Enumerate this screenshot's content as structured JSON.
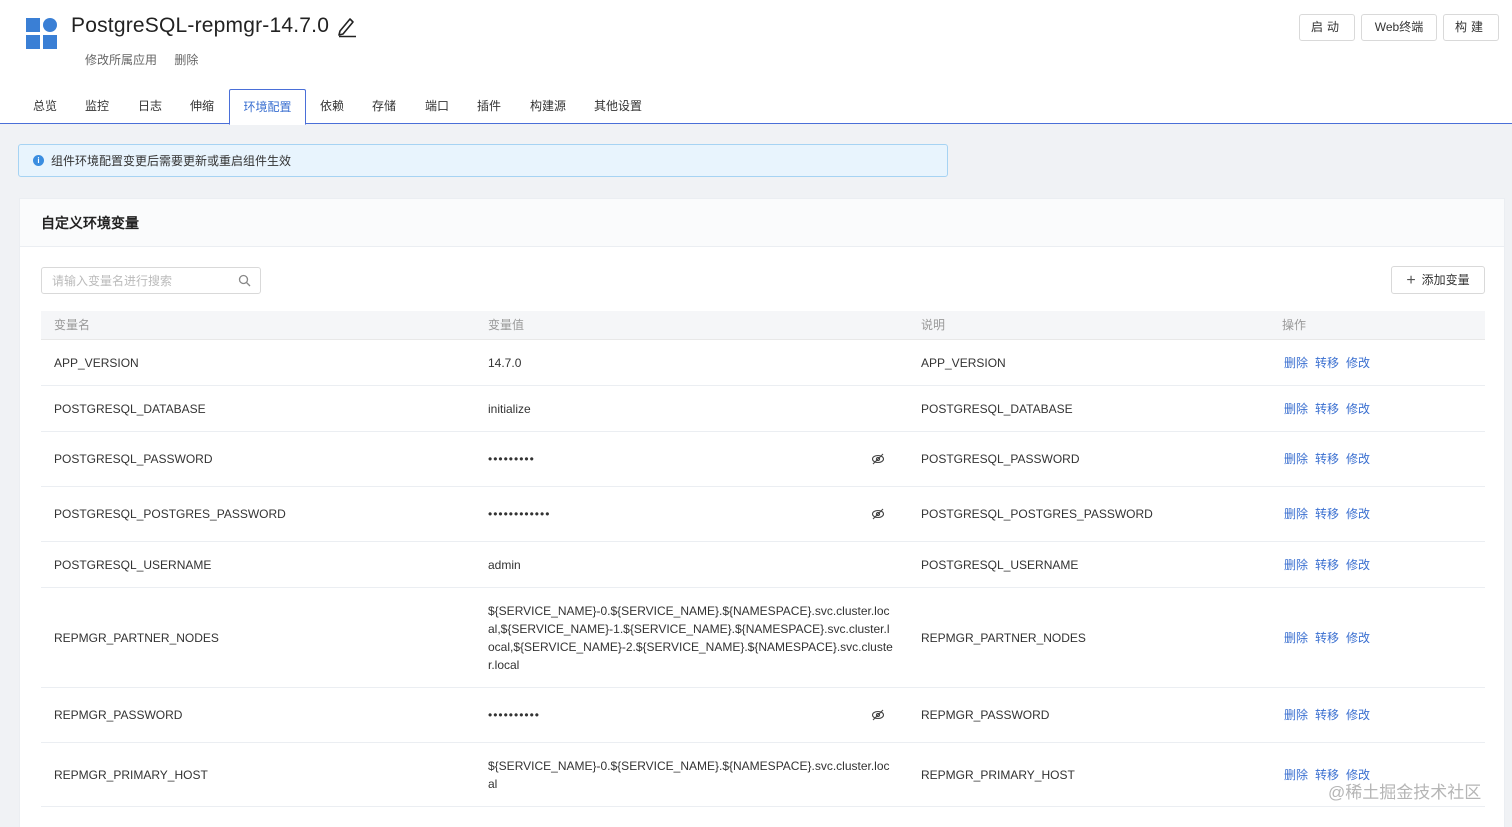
{
  "app": {
    "title": "PostgreSQL-repmgr-14.7.0",
    "sub_actions": [
      "修改所属应用",
      "删除"
    ]
  },
  "top_buttons": {
    "start": "启动",
    "web_terminal": "Web终端",
    "build": "构建"
  },
  "tabs": [
    {
      "label": "总览"
    },
    {
      "label": "监控"
    },
    {
      "label": "日志"
    },
    {
      "label": "伸缩"
    },
    {
      "label": "环境配置",
      "active": true
    },
    {
      "label": "依赖"
    },
    {
      "label": "存储"
    },
    {
      "label": "端口"
    },
    {
      "label": "插件"
    },
    {
      "label": "构建源"
    },
    {
      "label": "其他设置"
    }
  ],
  "alert": {
    "text": "组件环境配置变更后需要更新或重启组件生效"
  },
  "card": {
    "title": "自定义环境变量",
    "search_placeholder": "请输入变量名进行搜索",
    "add_button": "添加变量"
  },
  "table": {
    "headers": {
      "name": "变量名",
      "value": "变量值",
      "desc": "说明",
      "ops": "操作"
    },
    "op_labels": [
      "删除",
      "转移",
      "修改"
    ],
    "rows": [
      {
        "name": "APP_VERSION",
        "value": "14.7.0",
        "desc": "APP_VERSION"
      },
      {
        "name": "POSTGRESQL_DATABASE",
        "value": "initialize",
        "desc": "POSTGRESQL_DATABASE"
      },
      {
        "name": "POSTGRESQL_PASSWORD",
        "value": "•••••••••",
        "desc": "POSTGRESQL_PASSWORD",
        "masked": true
      },
      {
        "name": "POSTGRESQL_POSTGRES_PASSWORD",
        "value": "••••••••••••",
        "desc": "POSTGRESQL_POSTGRES_PASSWORD",
        "masked": true
      },
      {
        "name": "POSTGRESQL_USERNAME",
        "value": "admin",
        "desc": "POSTGRESQL_USERNAME"
      },
      {
        "name": "REPMGR_PARTNER_NODES",
        "value": "${SERVICE_NAME}-0.${SERVICE_NAME}.${NAMESPACE}.svc.cluster.local,${SERVICE_NAME}-1.${SERVICE_NAME}.${NAMESPACE}.svc.cluster.local,${SERVICE_NAME}-2.${SERVICE_NAME}.${NAMESPACE}.svc.cluster.local",
        "desc": "REPMGR_PARTNER_NODES"
      },
      {
        "name": "REPMGR_PASSWORD",
        "value": "••••••••••",
        "desc": "REPMGR_PASSWORD",
        "masked": true
      },
      {
        "name": "REPMGR_PRIMARY_HOST",
        "value": "${SERVICE_NAME}-0.${SERVICE_NAME}.${NAMESPACE}.svc.cluster.local",
        "desc": "REPMGR_PRIMARY_HOST"
      }
    ]
  },
  "watermark": "@稀土掘金技术社区",
  "colors": {
    "accent": "#3a6fd0",
    "logo": "#3a7fd5",
    "alert_bg": "#e8f4fd"
  }
}
